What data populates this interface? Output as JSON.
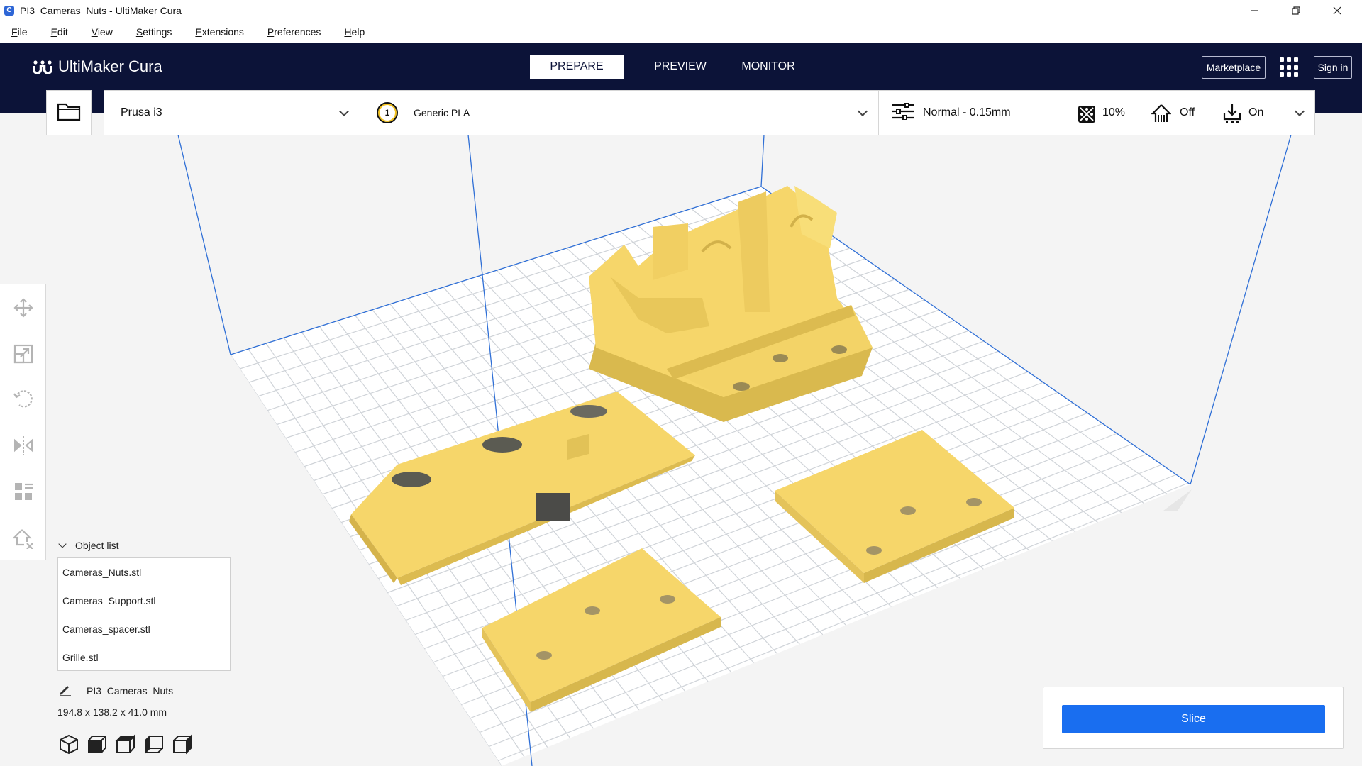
{
  "window": {
    "title": "PI3_Cameras_Nuts - UltiMaker Cura",
    "app_icon": "C",
    "controls": [
      "minimize-icon",
      "restore-icon",
      "close-icon"
    ]
  },
  "menu": {
    "items": [
      {
        "label": "File",
        "hotkey_index": 0
      },
      {
        "label": "Edit",
        "hotkey_index": 0
      },
      {
        "label": "View",
        "hotkey_index": 0
      },
      {
        "label": "Settings",
        "hotkey_index": 0
      },
      {
        "label": "Extensions",
        "hotkey_index": 0
      },
      {
        "label": "Preferences",
        "hotkey_index": 0
      },
      {
        "label": "Help",
        "hotkey_index": 0
      }
    ]
  },
  "header": {
    "brand": "UltiMaker Cura",
    "stages": [
      {
        "label": "PREPARE",
        "active": true
      },
      {
        "label": "PREVIEW",
        "active": false
      },
      {
        "label": "MONITOR",
        "active": false
      }
    ],
    "marketplace": "Marketplace",
    "sign_in": "Sign in",
    "colors": {
      "header_bg": "#0c1338",
      "accent": "#196ef0",
      "model": "#f6d66a"
    }
  },
  "toolbar": {
    "printer": "Prusa i3",
    "extruder_index": "1",
    "material": "Generic PLA",
    "profile": "Normal - 0.15mm",
    "infill": "10%",
    "support": "Off",
    "adhesion": "On"
  },
  "tools": [
    "move-icon",
    "scale-icon",
    "rotate-icon",
    "mirror-icon",
    "per-model-settings-icon",
    "support-blocker-icon"
  ],
  "object_list": {
    "header": "Object list",
    "items": [
      "Cameras_Nuts.stl",
      "Cameras_Support.stl",
      "Cameras_spacer.stl",
      "Grille.stl"
    ],
    "project_name": "PI3_Cameras_Nuts",
    "dimensions": "194.8 x 138.2 x 41.0 mm",
    "view_buttons": [
      "3d-view-icon",
      "front-view-icon",
      "top-view-icon",
      "left-view-icon",
      "right-view-icon"
    ]
  },
  "slice": {
    "label": "Slice"
  }
}
